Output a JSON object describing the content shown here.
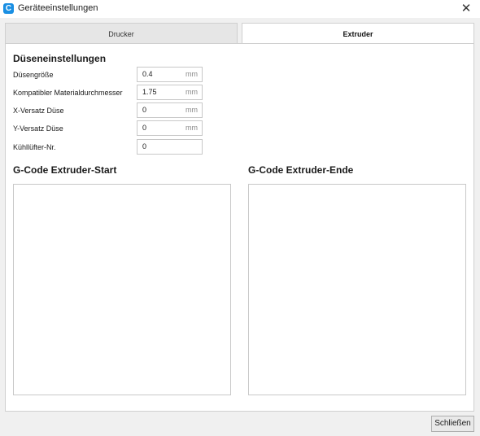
{
  "window": {
    "title": "Geräteeinstellungen",
    "app_icon_glyph": "C",
    "close_glyph": "✕"
  },
  "tabs": [
    {
      "label": "Drucker",
      "active": false
    },
    {
      "label": "Extruder",
      "active": true
    }
  ],
  "nozzle_settings": {
    "heading": "Düseneinstellungen",
    "fields": [
      {
        "label": "Düsengröße",
        "value": "0.4",
        "unit": "mm"
      },
      {
        "label": "Kompatibler Materialdurchmesser",
        "value": "1.75",
        "unit": "mm"
      },
      {
        "label": "X-Versatz Düse",
        "value": "0",
        "unit": "mm"
      },
      {
        "label": "Y-Versatz Düse",
        "value": "0",
        "unit": "mm"
      },
      {
        "label": "Kühllüfter-Nr.",
        "value": "0",
        "unit": ""
      }
    ]
  },
  "gcode": {
    "start_heading": "G-Code Extruder-Start",
    "end_heading": "G-Code Extruder-Ende",
    "start_value": "",
    "end_value": ""
  },
  "footer": {
    "close_label": "Schließen"
  },
  "colors": {
    "accent": "#1a8fe3",
    "window_bg": "#f0f0f0",
    "panel_bg": "#ffffff"
  }
}
